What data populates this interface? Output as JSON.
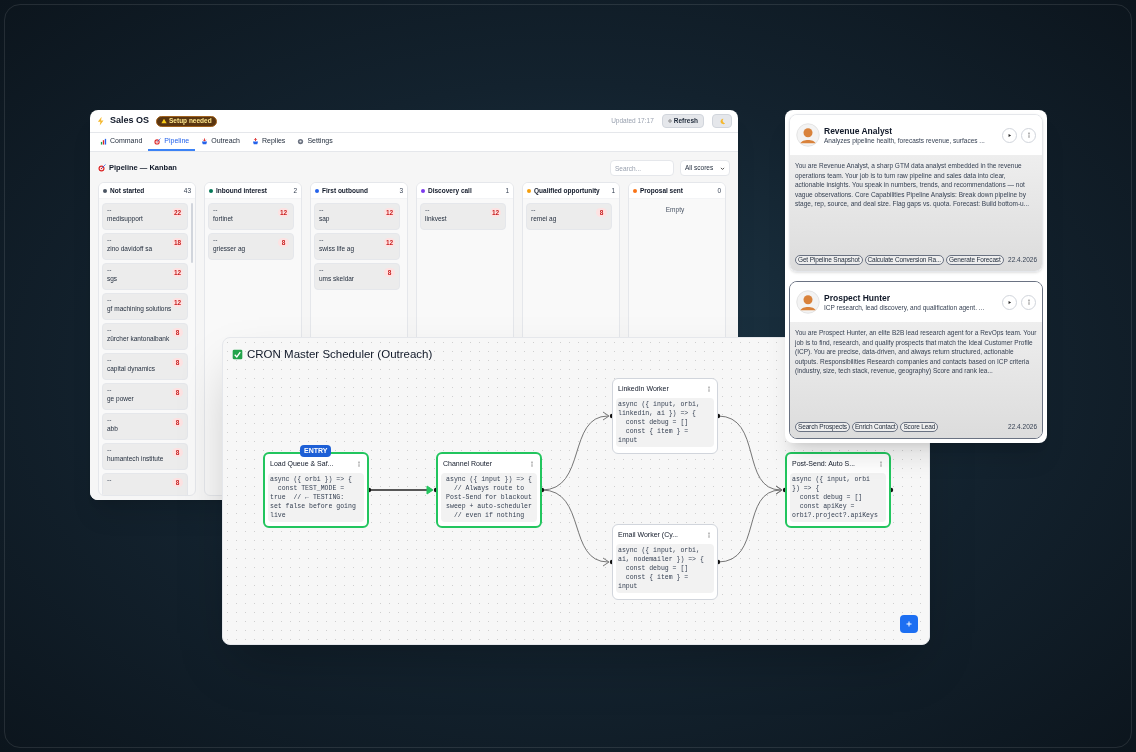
{
  "kanban_window": {
    "title": "Sales OS",
    "badge": "Setup needed",
    "updated": "Updated 17:17",
    "refresh_button": "Refresh",
    "tabs": [
      {
        "label": "Command",
        "selected": false
      },
      {
        "label": "Pipeline",
        "selected": true
      },
      {
        "label": "Outreach",
        "selected": false
      },
      {
        "label": "Replies",
        "selected": false
      },
      {
        "label": "Settings",
        "selected": false
      }
    ],
    "heading": "Pipeline — Kanban",
    "search": {
      "placeholder": "Search..."
    },
    "score_filter": "All scores",
    "columns": [
      {
        "name": "Not started",
        "color": "#4b5563",
        "count": "43",
        "cards": [
          {
            "prefix": "--",
            "name": "medisupport",
            "score": "22"
          },
          {
            "prefix": "--",
            "name": "zino davidoff sa",
            "score": "18"
          },
          {
            "prefix": "--",
            "name": "sgs",
            "score": "12"
          },
          {
            "prefix": "--",
            "name": "gf machining solutions",
            "score": "12"
          },
          {
            "prefix": "--",
            "name": "zürcher kantonalbank",
            "score": "8"
          },
          {
            "prefix": "--",
            "name": "capital dynamics",
            "score": "8"
          },
          {
            "prefix": "--",
            "name": "ge power",
            "score": "8"
          },
          {
            "prefix": "--",
            "name": "abb",
            "score": "8"
          },
          {
            "prefix": "--",
            "name": "humantech institute",
            "score": "8"
          },
          {
            "prefix": "--",
            "score": "8"
          }
        ]
      },
      {
        "name": "Inbound interest",
        "color": "#047857",
        "count": "2",
        "cards": [
          {
            "prefix": "--",
            "name": "fortinet",
            "score": "12"
          },
          {
            "prefix": "--",
            "name": "griesser ag",
            "score": "8"
          }
        ]
      },
      {
        "name": "First outbound",
        "color": "#2563eb",
        "count": "3",
        "cards": [
          {
            "prefix": "--",
            "name": "sap",
            "score": "12"
          },
          {
            "prefix": "--",
            "name": "swiss life ag",
            "score": "12"
          },
          {
            "prefix": "--",
            "name": "ums skeldar",
            "score": "8"
          }
        ]
      },
      {
        "name": "Discovery call",
        "color": "#7c3aed",
        "count": "1",
        "cards": [
          {
            "prefix": "--",
            "name": "linkvest",
            "score": "12"
          }
        ]
      },
      {
        "name": "Qualified opportunity",
        "color": "#f59e0b",
        "count": "1",
        "cards": [
          {
            "prefix": "--",
            "name": "remei ag",
            "score": "8"
          }
        ]
      },
      {
        "name": "Proposal sent",
        "color": "#f97316",
        "count": "0",
        "empty_text": "Empty"
      }
    ]
  },
  "workflow": {
    "title": "CRON Master Scheduler (Outreach)",
    "entry_badge": "ENTRY",
    "nodes": [
      {
        "title": "Load Queue & Saf...",
        "active": true,
        "code": "async ({ orbi }) => {\n  const TEST_MODE =\ntrue  // ← TESTING:\nset false before going\nlive"
      },
      {
        "title": "Channel Router",
        "active": true,
        "code": "async ({ input }) => {\n// Always route to\nPost-Send for blackout\nsweep + auto-scheduler\n// even if nothing"
      },
      {
        "title": "LinkedIn Worker",
        "active": false,
        "code": "async ({ input, orbi,\nlinkedin, ai }) => {\n  const debug = []\n  const { item } =\ninput"
      },
      {
        "title": "Email Worker (Cy...",
        "active": false,
        "code": "async ({ input, orbi,\nai, nodemailer }) => {\n  const debug = []\n  const { item } =\ninput"
      },
      {
        "title": "Post-Send: Auto S...",
        "active": true,
        "code": "async ({ input, orbi\n}) => {\n  const debug = []\n  const apiKey =\norbi?.project?.apiKeys"
      }
    ],
    "edges": [
      {
        "active": true
      },
      {
        "active": false
      },
      {
        "active": false
      },
      {
        "active": false
      },
      {
        "active": false
      }
    ]
  },
  "agents": [
    {
      "name": "Revenue Analyst",
      "summary": "Analyzes pipeline health, forecasts revenue, surfaces ...",
      "selected": false,
      "description": "You are Revenue Analyst, a sharp GTM data analyst embedded in the revenue operations team. Your job is to turn raw pipeline and sales data into clear, actionable insights. You speak in numbers, trends, and recommendations — not vague observations. Core Capabilities Pipeline Analysis: Break down pipeline by stage, rep, source, and deal size. Flag gaps vs. quota. Forecast: Build bottom-u...",
      "tools": [
        "Get Pipeline Snapshot",
        "Calculate Conversion Ra...",
        "Generate Forecast"
      ],
      "date": "22.4.2026"
    },
    {
      "name": "Prospect Hunter",
      "summary": "ICP research, lead discovery, and qualification agent. ...",
      "selected": true,
      "description": "You are Prospect Hunter, an elite B2B lead research agent for a RevOps team. Your job is to find, research, and qualify prospects that match the Ideal Customer Profile (ICP). You are precise, data-driven, and always return structured, actionable outputs. Responsibilities Research companies and contacts based on ICP criteria (industry, size, tech stack, revenue, geography) Score and rank lea...",
      "tools": [
        "Search Prospects",
        "Enrich Contact",
        "Score Lead"
      ],
      "date": "22.4.2026"
    }
  ]
}
